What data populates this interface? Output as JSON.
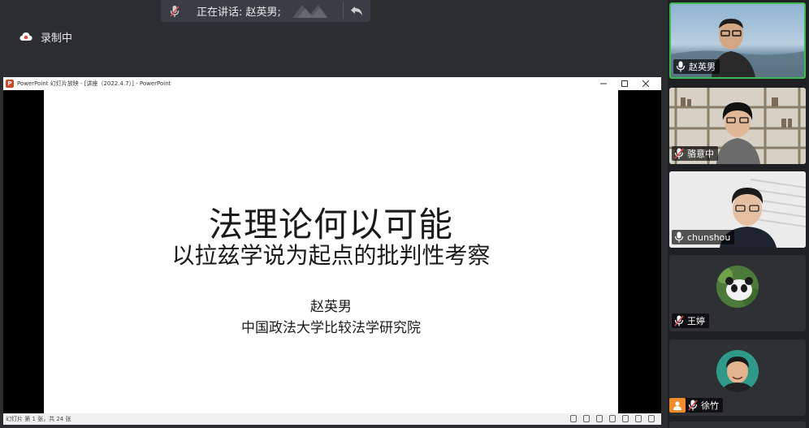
{
  "meeting": {
    "speaking_text": "正在讲话: 赵英男;",
    "recording_label": "录制中"
  },
  "powerpoint": {
    "window_title": "PowerPoint 幻灯片放映 - [讲座（2022.4.7）] - PowerPoint",
    "status_text": "幻灯片 第 1 张，共 24 张",
    "slide": {
      "title": "法理论何以可能",
      "subtitle": "以拉兹学说为起点的批判性考察",
      "author": "赵英男",
      "affiliation": "中国政法大学比较法学研究院"
    }
  },
  "participants": [
    {
      "name": "赵英男",
      "mic": "on",
      "active": true
    },
    {
      "name": "骆意中",
      "mic": "muted",
      "active": false
    },
    {
      "name": "chunshou",
      "mic": "on",
      "active": false
    },
    {
      "name": "王婷",
      "mic": "muted",
      "active": false
    },
    {
      "name": "徐竹",
      "mic": "muted",
      "active": false
    }
  ],
  "colors": {
    "active_border": "#3fb950",
    "muted_red": "#e5484d",
    "record_red": "#e5484d",
    "ppt_orange": "#d24726"
  },
  "icons": [
    "microphone-muted-icon",
    "reply-icon",
    "cloud-record-icon",
    "microphone-icon",
    "user-badge-icon"
  ]
}
